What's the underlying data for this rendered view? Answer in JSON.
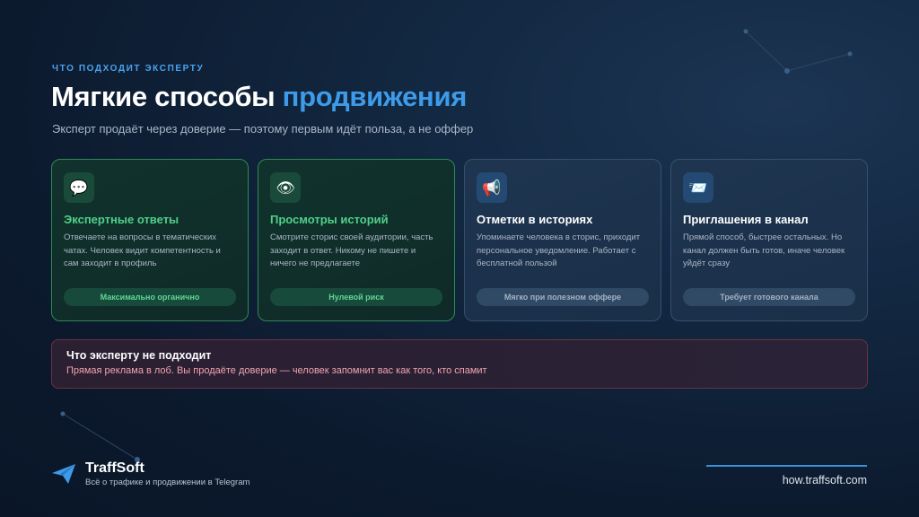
{
  "header": {
    "eyebrow": "ЧТО ПОДХОДИТ ЭКСПЕРТУ",
    "title_main": "Мягкие способы ",
    "title_accent": "продвижения",
    "subtitle": "Эксперт продаёт через доверие — поэтому первым идёт польза, а не оффер"
  },
  "cards": [
    {
      "icon": "speech-bubble-icon",
      "glyph": "💬",
      "title": "Экспертные ответы",
      "text": "Отвечаете на вопросы в тематических чатах. Человек видит компетентность и сам заходит в профиль",
      "badge": "Максимально органично"
    },
    {
      "icon": "eye-icon",
      "glyph": "👁",
      "title": "Просмотры историй",
      "text": "Смотрите сторис своей аудитории, часть заходит в ответ. Никому не пишете и ничего не предлагаете",
      "badge": "Нулевой риск"
    },
    {
      "icon": "megaphone-icon",
      "glyph": "📢",
      "title": "Отметки в историях",
      "text": "Упоминаете человека в сторис, приходит персональное уведомление. Работает с бесплатной пользой",
      "badge": "Мягко при полезном оффере"
    },
    {
      "icon": "incoming-envelope-icon",
      "glyph": "📨",
      "title": "Приглашения в канал",
      "text": "Прямой способ, быстрее остальных. Но канал должен быть готов, иначе человек уйдёт сразу",
      "badge": "Требует готового канала"
    }
  ],
  "warning": {
    "title": "Что эксперту не подходит",
    "text": "Прямая реклама в лоб. Вы продаёте доверие — человек запомнит вас как того, кто спамит"
  },
  "footer": {
    "brand": "TraffSoft",
    "tagline": "Всё о трафике и продвижении в Telegram",
    "site": "how.traffsoft.com"
  },
  "colors": {
    "accent": "#3d9be9",
    "green": "#4fd08a",
    "warning_text": "#f0a4ae",
    "background": "#0c1a2e"
  }
}
